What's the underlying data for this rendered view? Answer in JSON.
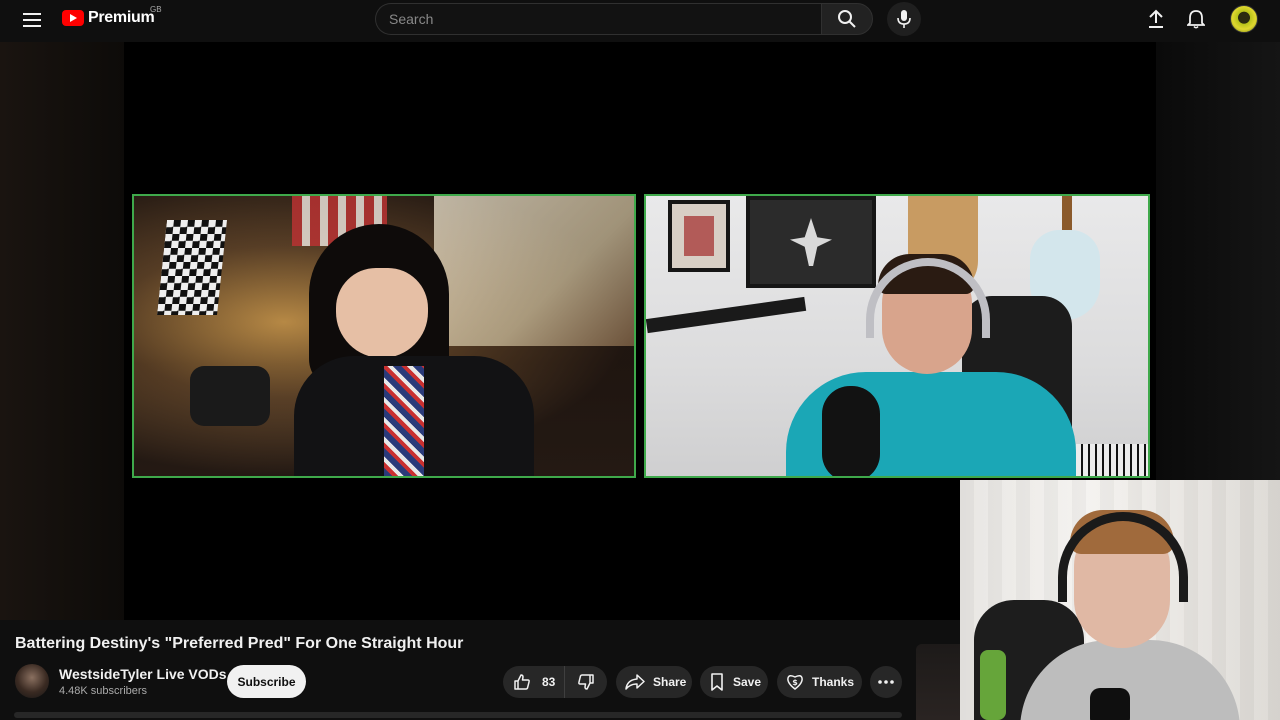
{
  "header": {
    "logo_text": "Premium",
    "country_code": "GB",
    "search_placeholder": "Search",
    "icons": {
      "menu": "hamburger-menu-icon",
      "search": "search-icon",
      "mic": "microphone-icon",
      "upload": "upload-icon",
      "notifications": "bell-icon"
    }
  },
  "video": {
    "title": "Battering Destiny's \"Preferred Pred\" For One Straight Hour",
    "channel_name": "WestsideTyler Live VODs",
    "subscribers": "4.48K subscribers",
    "subscribe_label": "Subscribe",
    "like_count": "83",
    "share_label": "Share",
    "save_label": "Save",
    "thanks_label": "Thanks"
  },
  "colors": {
    "brand_red": "#ff0000",
    "cam_border": "#3fa94b",
    "background": "#0f0f0f"
  }
}
